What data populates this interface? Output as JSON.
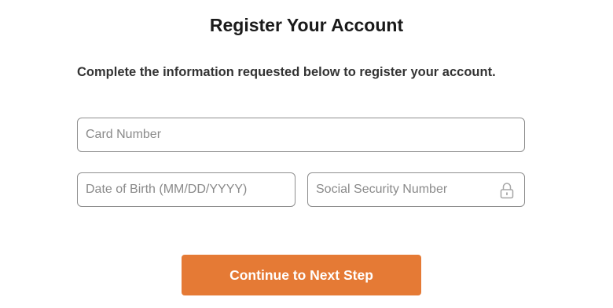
{
  "form": {
    "title": "Register Your Account",
    "instructions": "Complete the information requested below to register your account.",
    "card_number": {
      "placeholder": "Card Number",
      "value": ""
    },
    "date_of_birth": {
      "placeholder": "Date of Birth (MM/DD/YYYY)",
      "value": ""
    },
    "ssn": {
      "placeholder": "Social Security Number",
      "value": "",
      "icon": "lock-icon"
    },
    "continue_label": "Continue to Next Step"
  },
  "colors": {
    "accent": "#e57a35",
    "field_border": "#8f8f8f",
    "placeholder": "#8a8a8a",
    "title_text": "#1a1a1a"
  }
}
